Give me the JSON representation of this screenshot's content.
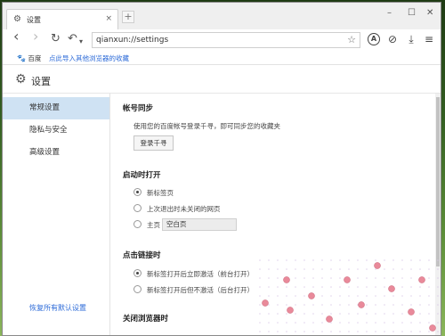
{
  "tab": {
    "title": "设置",
    "close": "×",
    "new": "+"
  },
  "window_controls": {
    "minimize": "–",
    "maximize": "☐",
    "close": "✕"
  },
  "nav": {
    "back": "‹",
    "forward": "›",
    "reload": "↻",
    "undo": "↶",
    "undo_menu": "▾"
  },
  "address": {
    "url": "qianxun://settings",
    "star": "☆"
  },
  "right_tools": {
    "a": "A",
    "compass": "⊘",
    "download": "⤓",
    "menu": "≡"
  },
  "bookmarks": {
    "baidu": "百度",
    "import": "点此导入其他浏览器的收藏"
  },
  "header": {
    "title": "设置"
  },
  "sidebar": {
    "items": [
      {
        "label": "常规设置"
      },
      {
        "label": "隐私与安全"
      },
      {
        "label": "高级设置"
      }
    ],
    "restore": "恢复所有默认设置"
  },
  "sections": {
    "account": {
      "title": "帐号同步",
      "desc": "使用您的百度帐号登录千寻，即可同步您的收藏夹",
      "button": "登录千寻"
    },
    "startup": {
      "title": "启动时打开",
      "options": [
        {
          "label": "新标签页",
          "checked": true
        },
        {
          "label": "上次退出时未关闭的网页",
          "checked": false
        },
        {
          "label": "主页",
          "checked": false
        }
      ],
      "homepage_value": "空白页"
    },
    "link": {
      "title": "点击链接时",
      "options": [
        {
          "label": "新标签打开后立即激活（前台打开）",
          "checked": true
        },
        {
          "label": "新标签打开后但不激活（后台打开）",
          "checked": false
        }
      ]
    },
    "close": {
      "title": "关闭浏览器时"
    }
  }
}
